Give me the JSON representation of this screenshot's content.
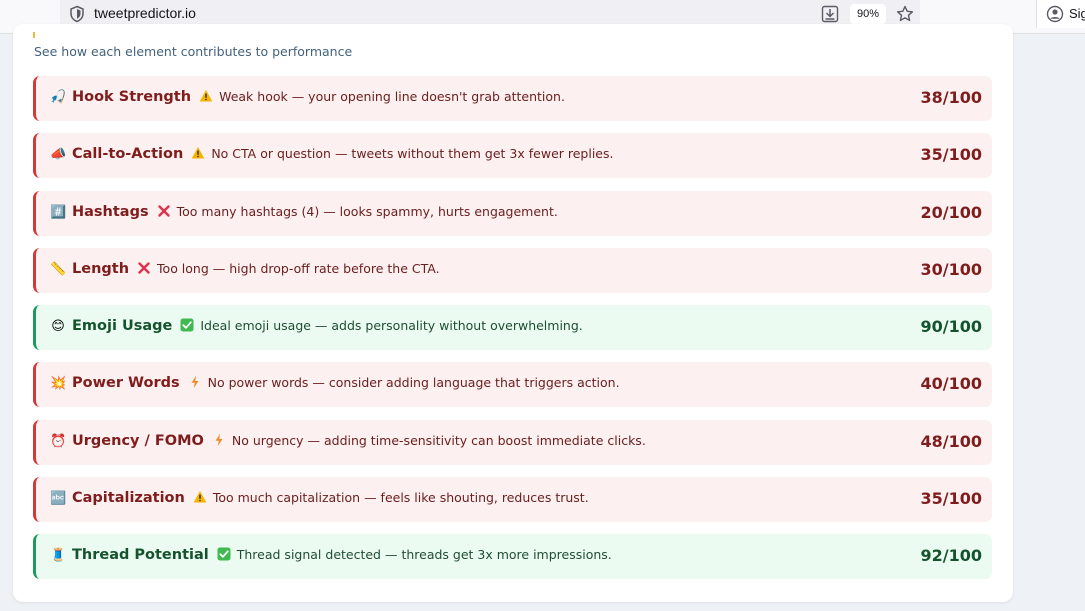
{
  "browser": {
    "url": "tweetpredictor.io",
    "zoom": "90%",
    "signin_label": "Sig"
  },
  "section": {
    "subtitle": "See how each element contributes to performance"
  },
  "colors": {
    "bad_border": "#d13a3a",
    "bad_bg": "#fdf0f0",
    "good_border": "#1f9a5e",
    "good_bg": "#ecfbf1"
  },
  "factors": [
    {
      "name": "Hook Strength",
      "emoji": "🎣",
      "status": "warning",
      "message": "Weak hook — your opening line doesn't grab attention.",
      "score": "38/100",
      "tone": "bad"
    },
    {
      "name": "Call-to-Action",
      "emoji": "📣",
      "status": "warning",
      "message": "No CTA or question — tweets without them get 3x fewer replies.",
      "score": "35/100",
      "tone": "bad"
    },
    {
      "name": "Hashtags",
      "emoji": "#️⃣",
      "status": "cross",
      "message": "Too many hashtags (4) — looks spammy, hurts engagement.",
      "score": "20/100",
      "tone": "bad"
    },
    {
      "name": "Length",
      "emoji": "📏",
      "status": "cross",
      "message": "Too long — high drop-off rate before the CTA.",
      "score": "30/100",
      "tone": "bad"
    },
    {
      "name": "Emoji Usage",
      "emoji": "😊",
      "status": "check",
      "message": "Ideal emoji usage — adds personality without overwhelming.",
      "score": "90/100",
      "tone": "good"
    },
    {
      "name": "Power Words",
      "emoji": "💥",
      "status": "bolt",
      "message": "No power words — consider adding language that triggers action.",
      "score": "40/100",
      "tone": "bad"
    },
    {
      "name": "Urgency / FOMO",
      "emoji": "⏰",
      "status": "bolt",
      "message": "No urgency — adding time-sensitivity can boost immediate clicks.",
      "score": "48/100",
      "tone": "bad"
    },
    {
      "name": "Capitalization",
      "emoji": "🔤",
      "status": "warning",
      "message": "Too much capitalization — feels like shouting, reduces trust.",
      "score": "35/100",
      "tone": "bad"
    },
    {
      "name": "Thread Potential",
      "emoji": "🧵",
      "status": "check",
      "message": "Thread signal detected — threads get 3x more impressions.",
      "score": "92/100",
      "tone": "good"
    }
  ]
}
